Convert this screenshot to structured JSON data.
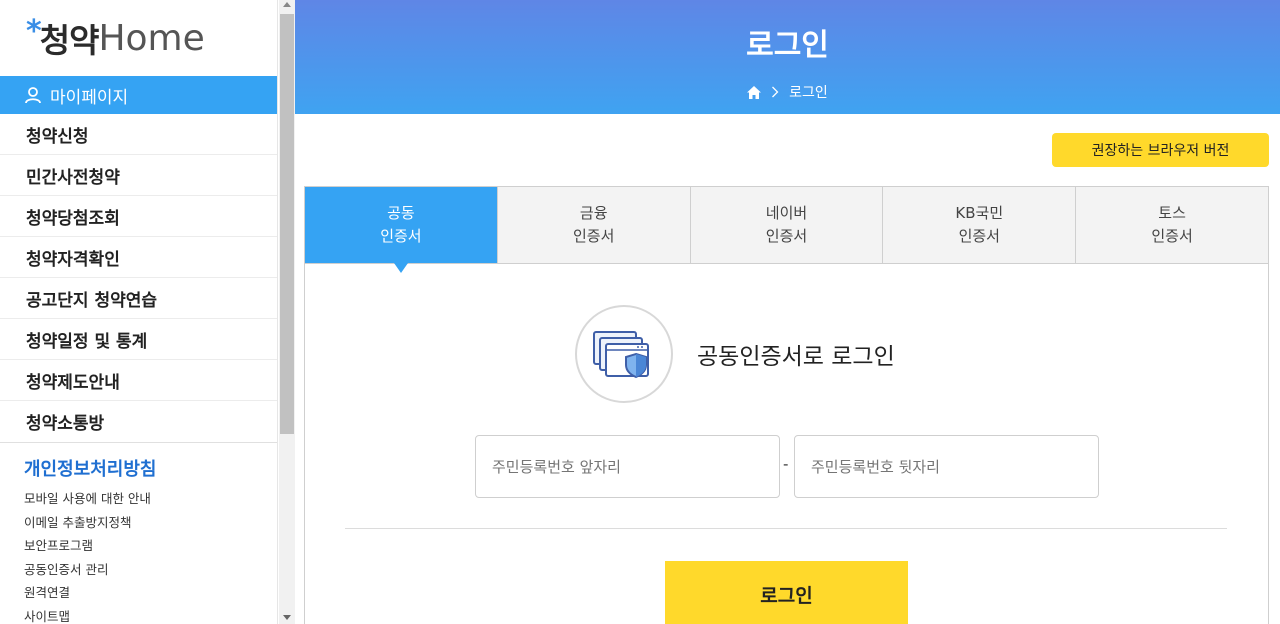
{
  "sidebar": {
    "logo": {
      "ko": "청약",
      "en": "Home"
    },
    "mypage": "마이페이지",
    "menu": [
      "청약신청",
      "민간사전청약",
      "청약당첨조회",
      "청약자격확인",
      "공고단지 청약연습",
      "청약일정 및 통계",
      "청약제도안내",
      "청약소통방"
    ],
    "privacy": "개인정보처리방침",
    "sublinks": [
      "모바일 사용에 대한 안내",
      "이메일 추출방지정책",
      "보안프로그램",
      "공동인증서 관리",
      "원격연결",
      "사이트맵"
    ]
  },
  "header": {
    "title": "로그인",
    "breadcrumb": [
      "로그인"
    ]
  },
  "browser_button": "권장하는 브라우저 버전",
  "tabs": [
    {
      "line1": "공동",
      "line2": "인증서",
      "active": true
    },
    {
      "line1": "금융",
      "line2": "인증서",
      "active": false
    },
    {
      "line1": "네이버",
      "line2": "인증서",
      "active": false
    },
    {
      "line1": "KB국민",
      "line2": "인증서",
      "active": false
    },
    {
      "line1": "토스",
      "line2": "인증서",
      "active": false
    }
  ],
  "login": {
    "heading": "공동인증서로 로그인",
    "front_placeholder": "주민등록번호 앞자리",
    "back_placeholder": "주민등록번호 뒷자리",
    "separator": "-",
    "button": "로그인"
  },
  "colors": {
    "accent": "#35a3f3",
    "yellow": "#ffd92b",
    "hero_top": "#5f86e6",
    "link": "#1f6fd1"
  },
  "icons": {
    "mypage": "user-icon",
    "home": "home-icon",
    "cert": "certificate-shield-icon"
  }
}
